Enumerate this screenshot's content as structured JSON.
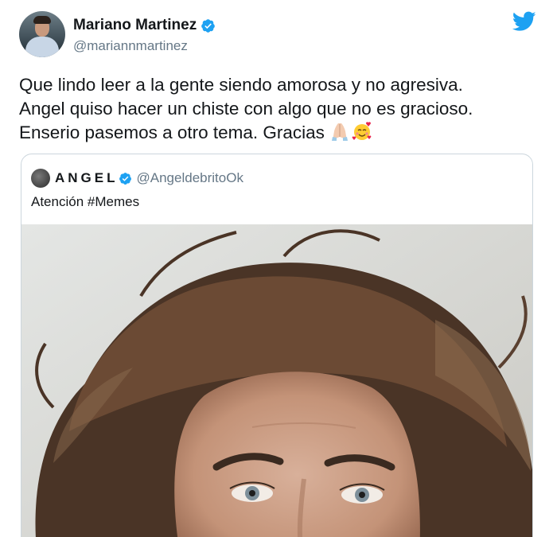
{
  "author": {
    "display_name": "Mariano Martinez",
    "handle": "@mariannmartinez",
    "verified": true
  },
  "tweet": {
    "text": "Que lindo leer a la gente siendo amorosa y no agresiva.\nAngel quiso hacer un chiste con algo que no es gracioso.\nEnserio pasemos a otro tema. Gracias",
    "emojis": [
      "folded-hands-emoji",
      "smiling-face-with-hearts-emoji"
    ]
  },
  "quoted_tweet": {
    "display_name": "ANGEL",
    "handle": "@AngeldebritoOk",
    "verified": true,
    "text": "Atención #Memes"
  },
  "colors": {
    "twitter_blue": "#1da1f2",
    "text": "#14171a",
    "secondary_text": "#657786",
    "border": "#ccd6dd"
  }
}
